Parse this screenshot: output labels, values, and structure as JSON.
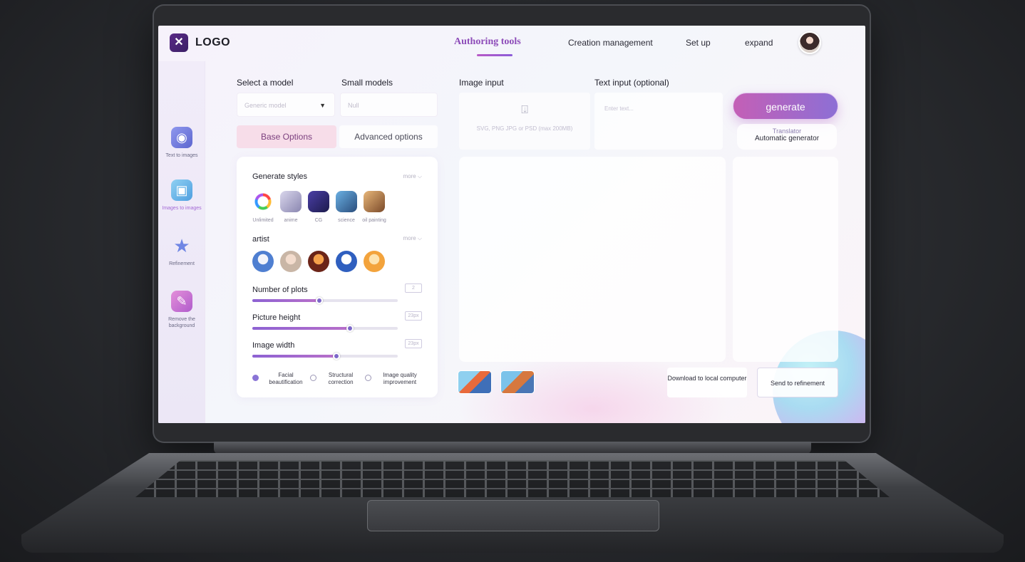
{
  "header": {
    "logo_text": "LOGO",
    "nav": [
      "Authoring tools",
      "Creation management",
      "Set up",
      "expand"
    ],
    "active_nav": "Authoring tools"
  },
  "rail": {
    "items": [
      {
        "label": "Text to images",
        "icon": "chat-robot-icon",
        "color": "#6c74d8"
      },
      {
        "label": "Images to images",
        "icon": "picture-icon",
        "color": "#6bb0e8"
      },
      {
        "label": "Refinement",
        "icon": "star-icon",
        "color": "#7d8fe6"
      },
      {
        "label": "Remove the background",
        "icon": "eraser-icon",
        "color": "#cf7ad6"
      }
    ],
    "active": "Images to images"
  },
  "model": {
    "label": "Select a model",
    "value": "Generic model",
    "small_label": "Small models",
    "small_value": "Null"
  },
  "tabs": {
    "base": "Base Options",
    "advanced": "Advanced options"
  },
  "panel": {
    "styles_title": "Generate styles",
    "more": "more",
    "styles": [
      "Unlimited",
      "anime",
      "CG",
      "science",
      "oil painting"
    ],
    "artist_title": "artist",
    "sliders": [
      {
        "label": "Number of plots",
        "value_text": "2",
        "fill": 0.46
      },
      {
        "label": "Picture height",
        "value_text": "23px",
        "fill": 0.67
      },
      {
        "label": "Image width",
        "value_text": "23px",
        "fill": 0.58
      }
    ],
    "options": [
      {
        "label": "Facial beautification",
        "checked": true
      },
      {
        "label": "Structural correction",
        "checked": false
      },
      {
        "label": "Image quality improvement",
        "checked": false
      }
    ]
  },
  "image_input": {
    "label": "Image input",
    "hint": "SVG, PNG JPG or PSD (max 200MB)"
  },
  "text_input": {
    "label": "Text input (optional)",
    "placeholder": "Enter text..."
  },
  "generate": {
    "label": "generate"
  },
  "translator": {
    "line1": "Translator",
    "line2": "Automatic generator"
  },
  "actions": {
    "download": "Download to local computer",
    "refine": "Send to refinement"
  },
  "colors": {
    "accent": "#8d4cb9",
    "generate_start": "#c45fb6",
    "generate_end": "#8d6fd5"
  }
}
